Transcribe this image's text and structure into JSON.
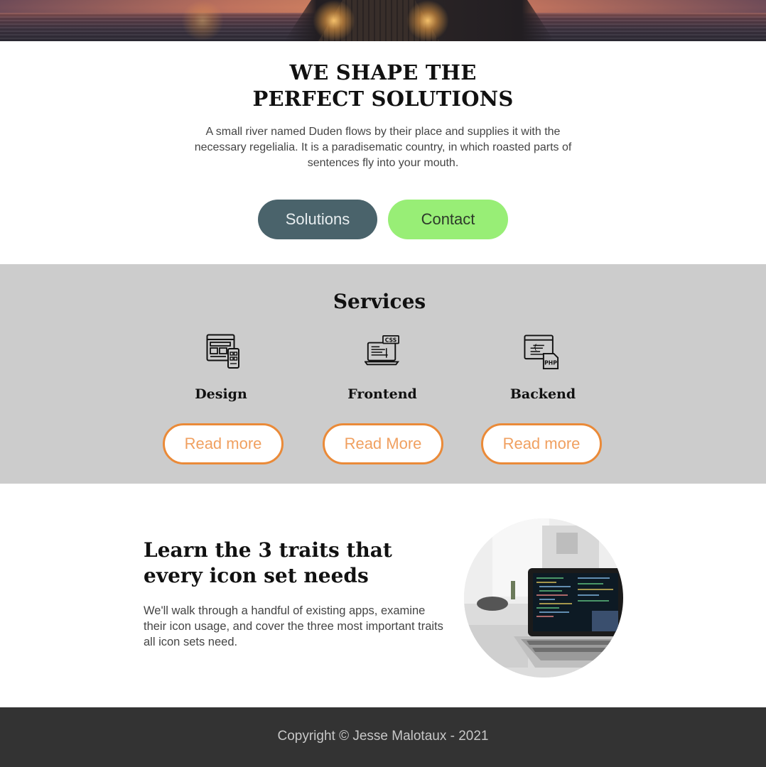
{
  "hero": {
    "title_line1": "WE SHAPE THE",
    "title_line2": "PERFECT SOLUTIONS",
    "description": "A small river named Duden flows by their place and supplies it with the necessary regelialia. It is a paradisematic country, in which roasted parts of sentences fly into your mouth.",
    "buttons": {
      "solutions": "Solutions",
      "contact": "Contact"
    }
  },
  "services": {
    "title": "Services",
    "items": [
      {
        "name": "Design",
        "icon": "web-design-icon",
        "button": "Read more"
      },
      {
        "name": "Frontend",
        "icon": "css-laptop-icon",
        "button": "Read More"
      },
      {
        "name": "Backend",
        "icon": "php-code-icon",
        "button": "Read more"
      }
    ]
  },
  "feature": {
    "title": "Learn the 3 traits that every icon set needs",
    "text": "We'll walk through a handful of existing apps, examine their icon usage, and cover the three most important traits all icon sets need."
  },
  "footer": {
    "copyright": "Copyright © Jesse Malotaux - 2021"
  },
  "colors": {
    "solutions_button": "#4a636b",
    "contact_button": "#98ee76",
    "services_bg": "#cccccc",
    "read_more_border": "#ea8a38",
    "footer_bg": "#333333"
  }
}
